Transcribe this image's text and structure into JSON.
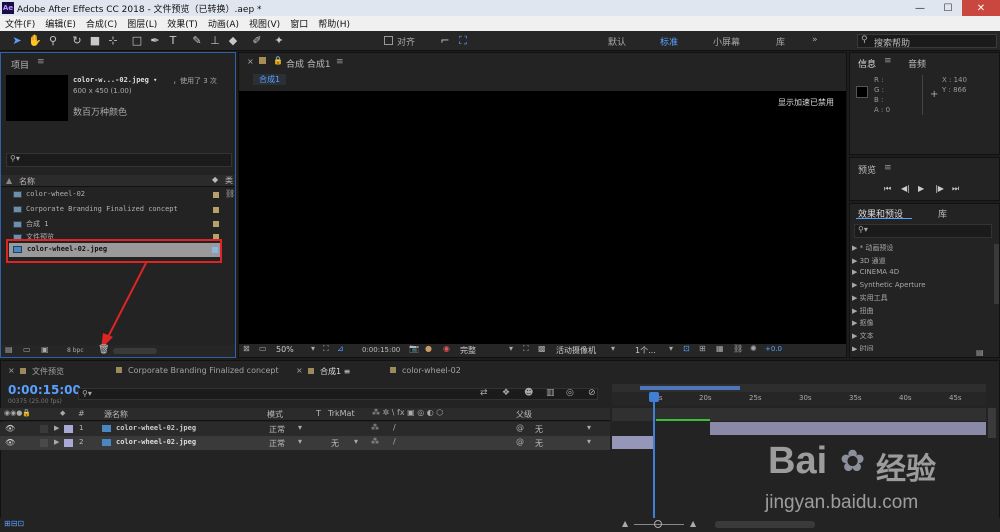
{
  "window": {
    "title": "Adobe After Effects CC 2018 - 文件预览（已转换）.aep *",
    "logo": "Ae"
  },
  "menu": [
    "文件(F)",
    "编辑(E)",
    "合成(C)",
    "图层(L)",
    "效果(T)",
    "动画(A)",
    "视图(V)",
    "窗口",
    "帮助(H)"
  ],
  "toolbar": {
    "snap_label": "对齐",
    "workspaces": [
      "默认",
      "标准",
      "小屏幕",
      "库"
    ],
    "active_workspace": "标准",
    "search_placeholder": "搜索帮助"
  },
  "project": {
    "title": "项目",
    "selected_name": "color-w...-02.jpeg ▾",
    "used_count": "，使用了 3 次",
    "dimensions": "600 x 450 (1.00)",
    "color_info": "数百万种颜色",
    "col_name": "名称",
    "items": [
      {
        "name": "color-wheel-02"
      },
      {
        "name": "Corporate Branding  Finalized concept"
      },
      {
        "name": "合成 1"
      },
      {
        "name": "文件预览"
      },
      {
        "name": "color-wheel-02.jpeg"
      }
    ],
    "bpc": "8 bpc"
  },
  "comp": {
    "title": "合成 合成1",
    "tab": "合成1",
    "overlay": "显示加速已禁用",
    "zoom": "50%",
    "timecode": "0:00:15:00",
    "quality": "完整",
    "camera": "活动摄像机",
    "views": "1个...",
    "exposure": "+0.0"
  },
  "info": {
    "tabs": [
      "信息",
      "音频"
    ],
    "r": "R :",
    "g": "G :",
    "b": "B :",
    "a": "A : 0",
    "x": "X : 140",
    "y": "Y : 866"
  },
  "preview": {
    "title": "预览"
  },
  "effects": {
    "tabs": [
      "效果和预设",
      "库"
    ],
    "items": [
      "▶ * 动画预设",
      "▶ 3D 通道",
      "▶ CINEMA 4D",
      "▶ Synthetic Aperture",
      "▶ 实用工具",
      "▶ 扭曲",
      "▶ 抠像",
      "▶ 文本",
      "▶ 时间"
    ]
  },
  "timeline": {
    "tabs": [
      "文件预览",
      "Corporate Branding  Finalized concept",
      "合成1",
      "color-wheel-02"
    ],
    "active_tab": "合成1",
    "timecode": "0:00:15:00",
    "frame_info": "00375 (25.00 fps)",
    "columns": {
      "hash": "#",
      "source": "源名称",
      "mode": "模式",
      "t": "T",
      "trkmat": "TrkMat",
      "parent": "父级"
    },
    "ruler": [
      "15s",
      "20s",
      "25s",
      "30s",
      "35s",
      "40s",
      "45s"
    ],
    "layers": [
      {
        "num": "1",
        "name": "color-wheel-02.jpeg",
        "mode": "正常",
        "trkmat": "",
        "parent": "无"
      },
      {
        "num": "2",
        "name": "color-wheel-02.jpeg",
        "mode": "正常",
        "trkmat": "无",
        "parent": "无"
      }
    ]
  },
  "watermark": {
    "brand": "Bai",
    "brand_cn": "经验",
    "url": "jingyan.baidu.com"
  }
}
